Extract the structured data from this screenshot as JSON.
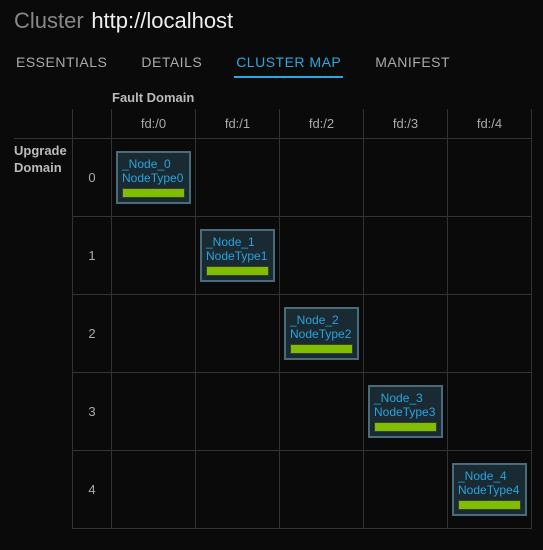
{
  "header": {
    "prefix": "Cluster",
    "url": "http://localhost"
  },
  "tabs": [
    {
      "label": "ESSENTIALS",
      "active": false
    },
    {
      "label": "DETAILS",
      "active": false
    },
    {
      "label": "CLUSTER MAP",
      "active": true
    },
    {
      "label": "MANIFEST",
      "active": false
    }
  ],
  "map": {
    "fault_domain_label": "Fault Domain",
    "upgrade_domain_label": "Upgrade\nDomain",
    "fault_domains": [
      "fd:/0",
      "fd:/1",
      "fd:/2",
      "fd:/3",
      "fd:/4"
    ],
    "upgrade_domains": [
      "0",
      "1",
      "2",
      "3",
      "4"
    ],
    "nodes": [
      {
        "ud": 0,
        "fd": 0,
        "name": "_Node_0",
        "type": "NodeType0",
        "health": "ok"
      },
      {
        "ud": 1,
        "fd": 1,
        "name": "_Node_1",
        "type": "NodeType1",
        "health": "ok"
      },
      {
        "ud": 2,
        "fd": 2,
        "name": "_Node_2",
        "type": "NodeType2",
        "health": "ok"
      },
      {
        "ud": 3,
        "fd": 3,
        "name": "_Node_3",
        "type": "NodeType3",
        "health": "ok"
      },
      {
        "ud": 4,
        "fd": 4,
        "name": "_Node_4",
        "type": "NodeType4",
        "health": "ok"
      }
    ],
    "colors": {
      "health_ok": "#7fbf00"
    }
  }
}
